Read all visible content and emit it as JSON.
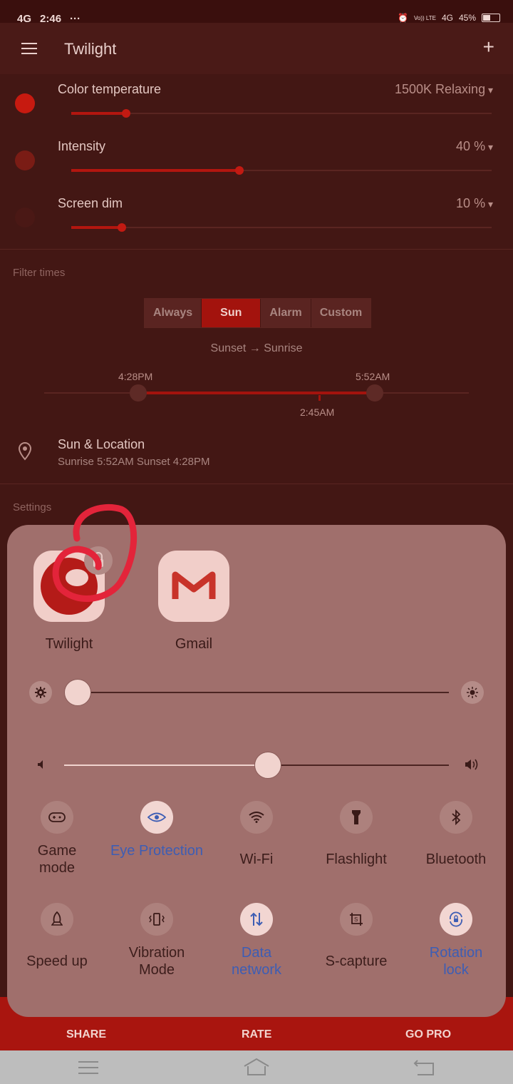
{
  "status_bar": {
    "network": "4G",
    "time": "2:46",
    "dots": "···",
    "carrier": "Vo)) LTE",
    "network_right": "4G",
    "battery": "45%"
  },
  "app_bar": {
    "title": "Twilight"
  },
  "filters": [
    {
      "label": "Color temperature",
      "value": "1500K Relaxing",
      "level": 0.13,
      "dot_color": "#c71a10"
    },
    {
      "label": "Intensity",
      "value": "40 %",
      "level": 0.4,
      "dot_color": "#7a1c15"
    },
    {
      "label": "Screen dim",
      "value": "10 %",
      "level": 0.12,
      "dot_color": "#4a1815"
    }
  ],
  "filter_times": {
    "heading": "Filter times",
    "tabs": [
      "Always",
      "Sun",
      "Alarm",
      "Custom"
    ],
    "selected_tab": "Sun",
    "caption": "Sunset → Sunrise",
    "start": "4:28PM",
    "end": "5:52AM",
    "now": "2:45AM"
  },
  "location": {
    "title": "Sun & Location",
    "subtitle": "Sunrise 5:52AM Sunset 4:28PM"
  },
  "settings_heading": "Settings",
  "bottom_actions": {
    "share": "SHARE",
    "rate": "RATE",
    "go_pro": "GO PRO"
  },
  "quick_panel": {
    "apps": [
      {
        "name": "Twilight",
        "icon": "twilight-app-icon"
      },
      {
        "name": "Gmail",
        "icon": "gmail-app-icon"
      }
    ],
    "brightness_level": 0.0,
    "volume_level": 0.53,
    "toggles_row1": [
      {
        "label": "Game mode",
        "icon": "gamepad-icon",
        "on": false
      },
      {
        "label": "Eye Protection",
        "icon": "eye-icon",
        "on": true
      },
      {
        "label": "Wi-Fi",
        "icon": "wifi-icon",
        "on": false
      },
      {
        "label": "Flashlight",
        "icon": "flashlight-icon",
        "on": false
      },
      {
        "label": "Bluetooth",
        "icon": "bluetooth-icon",
        "on": false
      }
    ],
    "toggles_row2": [
      {
        "label": "Speed up",
        "icon": "rocket-icon",
        "on": false
      },
      {
        "label": "Vibration Mode",
        "icon": "vibration-icon",
        "on": false
      },
      {
        "label": "Data network",
        "icon": "data-arrows-icon",
        "on": true
      },
      {
        "label": "S-capture",
        "icon": "screenshot-icon",
        "on": false
      },
      {
        "label": "Rotation lock",
        "icon": "rotation-lock-icon",
        "on": true
      }
    ],
    "accent_on": "#3d5db4"
  },
  "annotation_color": "#e3243a"
}
